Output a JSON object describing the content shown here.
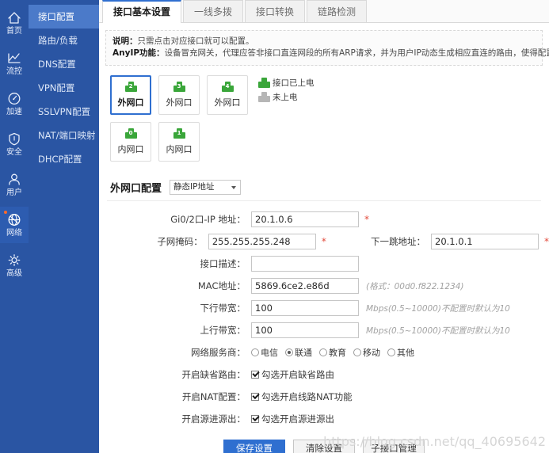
{
  "rail": {
    "items": [
      {
        "label": "首页",
        "icon": "home-icon",
        "active": false,
        "dot": false
      },
      {
        "label": "流控",
        "icon": "chart-line-icon",
        "active": false,
        "dot": false
      },
      {
        "label": "加速",
        "icon": "gauge-icon",
        "active": false,
        "dot": false
      },
      {
        "label": "安全",
        "icon": "shield-icon",
        "active": false,
        "dot": false
      },
      {
        "label": "用户",
        "icon": "user-icon",
        "active": false,
        "dot": false
      },
      {
        "label": "网络",
        "icon": "globe-icon",
        "active": true,
        "dot": true
      },
      {
        "label": "高级",
        "icon": "gear-icon",
        "active": false,
        "dot": false
      }
    ]
  },
  "menu": {
    "items": [
      {
        "label": "接口配置",
        "active": true
      },
      {
        "label": "路由/负载",
        "active": false
      },
      {
        "label": "DNS配置",
        "active": false
      },
      {
        "label": "VPN配置",
        "active": false
      },
      {
        "label": "SSLVPN配置",
        "active": false
      },
      {
        "label": "NAT/端口映射",
        "active": false
      },
      {
        "label": "DHCP配置",
        "active": false
      }
    ]
  },
  "tabs": [
    {
      "label": "接口基本设置",
      "active": true
    },
    {
      "label": "一线多拨",
      "active": false
    },
    {
      "label": "接口转换",
      "active": false
    },
    {
      "label": "链路检测",
      "active": false
    }
  ],
  "notice": {
    "line1_label": "说明：",
    "line1_text": "只需点击对应接口就可以配置。",
    "line2_label": "AnyIP功能：",
    "line2_text": "设备冒充网关，代理应答非接口直连网段的所有ARP请求，并为用户IP动态生成相应直连的路由，使得配置IP和网关的用户不修改配置也能上网。"
  },
  "ports": {
    "row1": [
      {
        "num": "2",
        "label": "外网口",
        "state": "powered",
        "selected": true
      },
      {
        "num": "3",
        "label": "外网口",
        "state": "powered",
        "selected": false
      },
      {
        "num": "4",
        "label": "外网口",
        "state": "powered",
        "selected": false
      }
    ],
    "row2": [
      {
        "num": "0",
        "label": "内网口",
        "state": "powered",
        "selected": false
      },
      {
        "num": "1",
        "label": "内网口",
        "state": "powered",
        "selected": false
      }
    ],
    "legend": [
      {
        "label": "接口已上电",
        "state": "powered"
      },
      {
        "label": "未上电",
        "state": "unpowered"
      }
    ]
  },
  "section": {
    "title": "外网口配置",
    "mode_select": "静态IP地址"
  },
  "form": {
    "ip": {
      "label": "Gi0/2口-IP 地址：",
      "value": "20.1.0.6",
      "required": true
    },
    "netmask": {
      "label": "子网掩码：",
      "value": "255.255.255.248",
      "required": true
    },
    "nexthop": {
      "label": "下一跳地址：",
      "value": "20.1.0.1",
      "required": true
    },
    "desc": {
      "label": "接口描述：",
      "value": "",
      "required": false
    },
    "mac": {
      "label": "MAC地址：",
      "value": "5869.6ce2.e86d",
      "hint": "(格式：00d0.f822.1234)"
    },
    "downlink": {
      "label": "下行带宽：",
      "value": "100",
      "hint": "Mbps(0.5~10000)不配置时默认为10"
    },
    "uplink": {
      "label": "上行带宽：",
      "value": "100",
      "hint": "Mbps(0.5~10000)不配置时默认为10"
    },
    "isp": {
      "label": "网络服务商：",
      "options": [
        {
          "label": "电信",
          "selected": false
        },
        {
          "label": "联通",
          "selected": true
        },
        {
          "label": "教育",
          "selected": false
        },
        {
          "label": "移动",
          "selected": false
        },
        {
          "label": "其他",
          "selected": false
        }
      ]
    },
    "default_route": {
      "label": "开启缺省路由：",
      "checkbox_label": "勾选开启缺省路由",
      "checked": true
    },
    "nat": {
      "label": "开启NAT配置：",
      "checkbox_label": "勾选开启线路NAT功能",
      "checked": true
    },
    "src_in_out": {
      "label": "开启源进源出：",
      "checkbox_label": "勾选开启源进源出",
      "checked": true
    }
  },
  "buttons": {
    "save": "保存设置",
    "clear": "清除设置",
    "subif": "子接口管理"
  },
  "watermark": "https://blog.csdn.net/qq_40695642",
  "colors": {
    "nav_blue": "#2a55a3",
    "accent_blue": "#2f6fd0",
    "port_green": "#3aa63a",
    "port_gray": "#b6b6b6",
    "required_red": "#e24a3b"
  }
}
